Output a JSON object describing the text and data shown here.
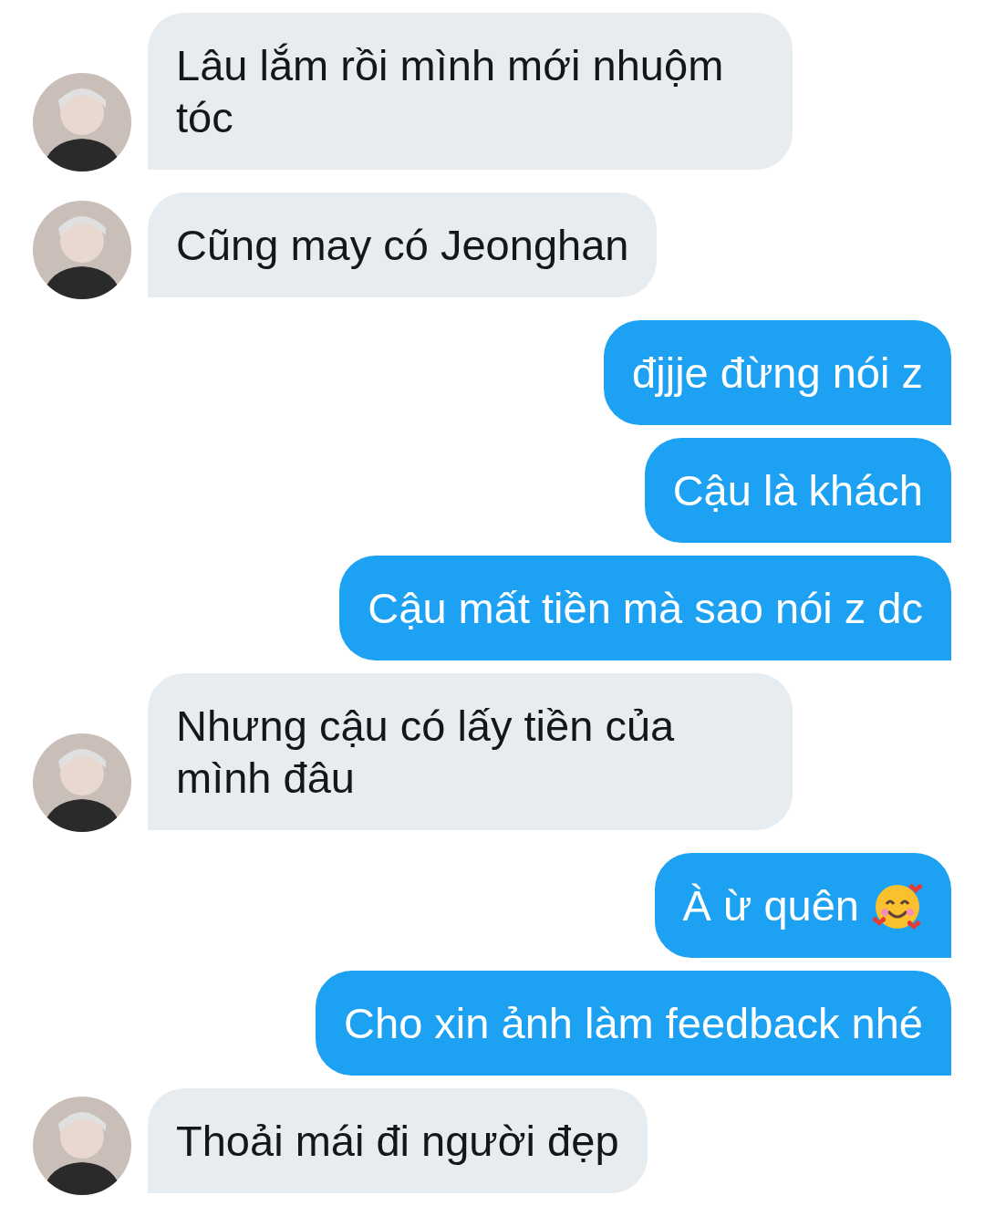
{
  "messages": [
    {
      "kind": "incoming",
      "text": "Lâu lắm rồi mình mới nhuộm tóc"
    },
    {
      "kind": "incoming",
      "text": "Cũng may có Jeonghan"
    },
    {
      "kind": "outgoing",
      "text": "đjjje đừng nói z"
    },
    {
      "kind": "outgoing",
      "text": "Cậu là khách"
    },
    {
      "kind": "outgoing",
      "text": "Cậu mất tiền mà sao nói z dc"
    },
    {
      "kind": "incoming",
      "text": "Nhưng cậu có lấy tiền của mình đâu"
    },
    {
      "kind": "outgoing",
      "text": "À ừ quên",
      "has_emoji": true
    },
    {
      "kind": "outgoing",
      "text": "Cho xin ảnh làm feedback nhé"
    },
    {
      "kind": "incoming",
      "text": "Thoải mái đi người đẹp"
    }
  ]
}
